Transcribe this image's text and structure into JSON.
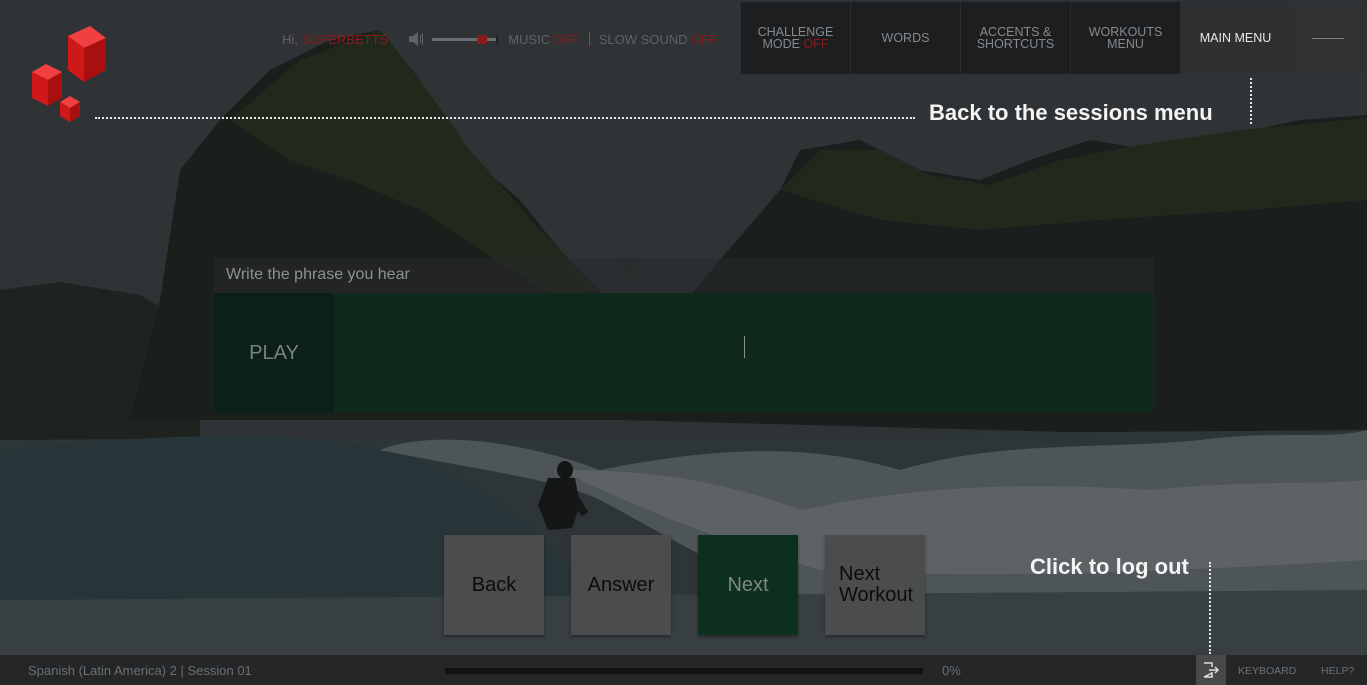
{
  "app": {
    "course_label": "Spanish (Latin America) 2 | Session 01",
    "progress_percent": 0,
    "progress_text": "0%"
  },
  "user": {
    "greeting_prefix": "Hi,",
    "username": "SUPERBETTS"
  },
  "sound_controls": {
    "volume_level": 0.8,
    "music_label": "MUSIC",
    "music_state": "OFF",
    "slow_sound_label": "SLOW SOUND",
    "slow_sound_state": "OFF"
  },
  "nav": {
    "challenge_line1": "CHALLENGE",
    "challenge_line2": "MODE",
    "challenge_state": "OFF",
    "words": "WORDS",
    "accents_line1": "ACCENTS &",
    "accents_line2": "SHORTCUTS",
    "workouts_line1": "WORKOUTS",
    "workouts_line2": "MENU",
    "main_menu": "MAIN MENU"
  },
  "hints": {
    "sessions_menu": "Back to the sessions menu",
    "log_out": "Click to log out"
  },
  "exercise": {
    "instruction": "Write the phrase you hear",
    "play_label": "PLAY",
    "answer_value": ""
  },
  "buttons": {
    "back": "Back",
    "answer": "Answer",
    "next": "Next",
    "next_workout_line1": "Next",
    "next_workout_line2": "Workout"
  },
  "footer": {
    "keyboard": "KEYBOARD",
    "help": "HELP?"
  },
  "colors": {
    "accent_red": "#8b1a1a",
    "accent_green": "#0c2f1f",
    "logo_red": "#e02020"
  },
  "icons": {
    "logo": "red-cubes-logo",
    "speaker": "speaker-icon",
    "mic": "microphone-icon",
    "logout": "logout-icon"
  }
}
